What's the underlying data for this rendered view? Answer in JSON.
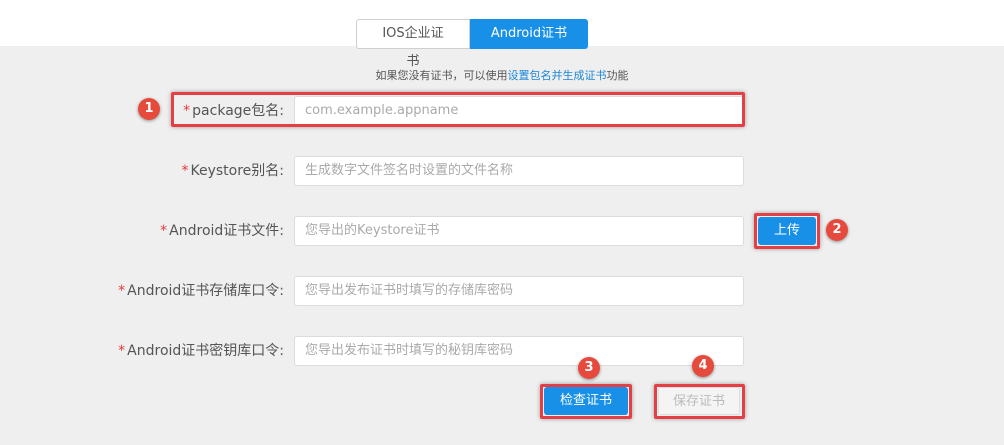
{
  "tabs": [
    {
      "label": "IOS企业证书",
      "active": false
    },
    {
      "label": "Android证书",
      "active": true
    }
  ],
  "hint": {
    "prefix": "如果您没有证书，可以使用",
    "link": "设置包名并生成证书",
    "suffix": "功能"
  },
  "form": {
    "required_mark": "*",
    "package": {
      "label": "package包名:",
      "placeholder": "com.example.appname"
    },
    "alias": {
      "label": "Keystore别名:",
      "placeholder": "生成数字文件签名时设置的文件名称"
    },
    "cert_file": {
      "label": "Android证书文件:",
      "placeholder": "您导出的Keystore证书"
    },
    "store_pass": {
      "label": "Android证书存储库口令:",
      "placeholder": "您导出发布证书时填写的存储库密码"
    },
    "key_pass": {
      "label": "Android证书密钥库口令:",
      "placeholder": "您导出发布证书时填写的秘钥库密码"
    }
  },
  "buttons": {
    "upload": "上传",
    "check": "检查证书",
    "save": "保存证书"
  },
  "badges": [
    "1",
    "2",
    "3",
    "4"
  ],
  "colors": {
    "accent": "#1890e8",
    "annotation_red": "#e53f46",
    "required": "#e53935"
  }
}
